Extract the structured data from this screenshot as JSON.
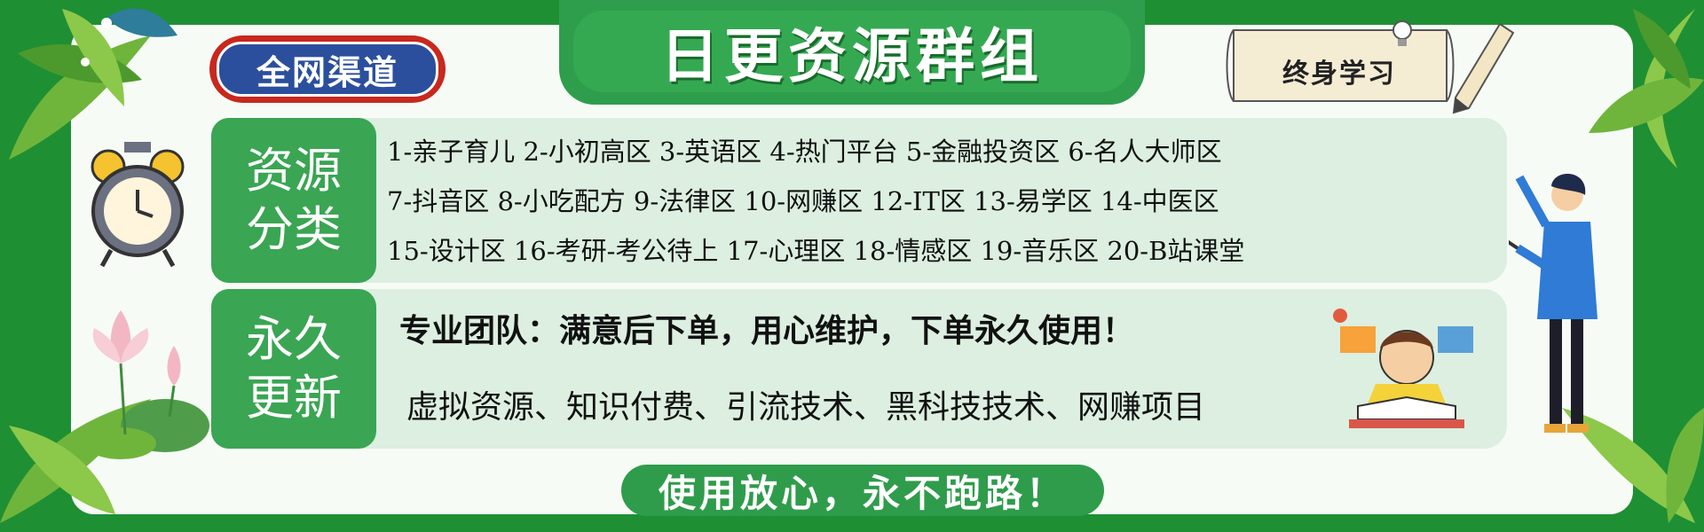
{
  "colors": {
    "frame_green": "#1f8f34",
    "accent_green": "#3aa553",
    "light_green": "#dcefe0",
    "badge_red": "#c8281e",
    "badge_blue": "#2b4f9c"
  },
  "header": {
    "title": "日更资源群组",
    "badge": "全网渠道",
    "tag": "终身学习"
  },
  "categories": {
    "label_line1": "资源",
    "label_line2": "分类",
    "rows": [
      "1-亲子育儿 2-小初高区 3-英语区 4-热门平台 5-金融投资区 6-名人大师区",
      "7-抖音区 8-小吃配方 9-法律区 10-网赚区 12-IT区 13-易学区 14-中医区",
      "15-设计区 16-考研-考公待上  17-心理区 18-情感区 19-音乐区  20-B站课堂"
    ]
  },
  "update": {
    "label_line1": "永久",
    "label_line2": "更新",
    "line1": "专业团队：满意后下单，用心维护，下单永久使用！",
    "line2": "虚拟资源、知识付费、引流技术、黑科技技术、网赚项目"
  },
  "footer": {
    "slogan": "使用放心，永不跑路！"
  },
  "icons": [
    "alarm-clock-icon",
    "lotus-flower-icon",
    "leaf-icon",
    "teacher-illustration",
    "student-reading-illustration",
    "scroll-icon",
    "pencil-icon",
    "lightbulb-icon"
  ]
}
